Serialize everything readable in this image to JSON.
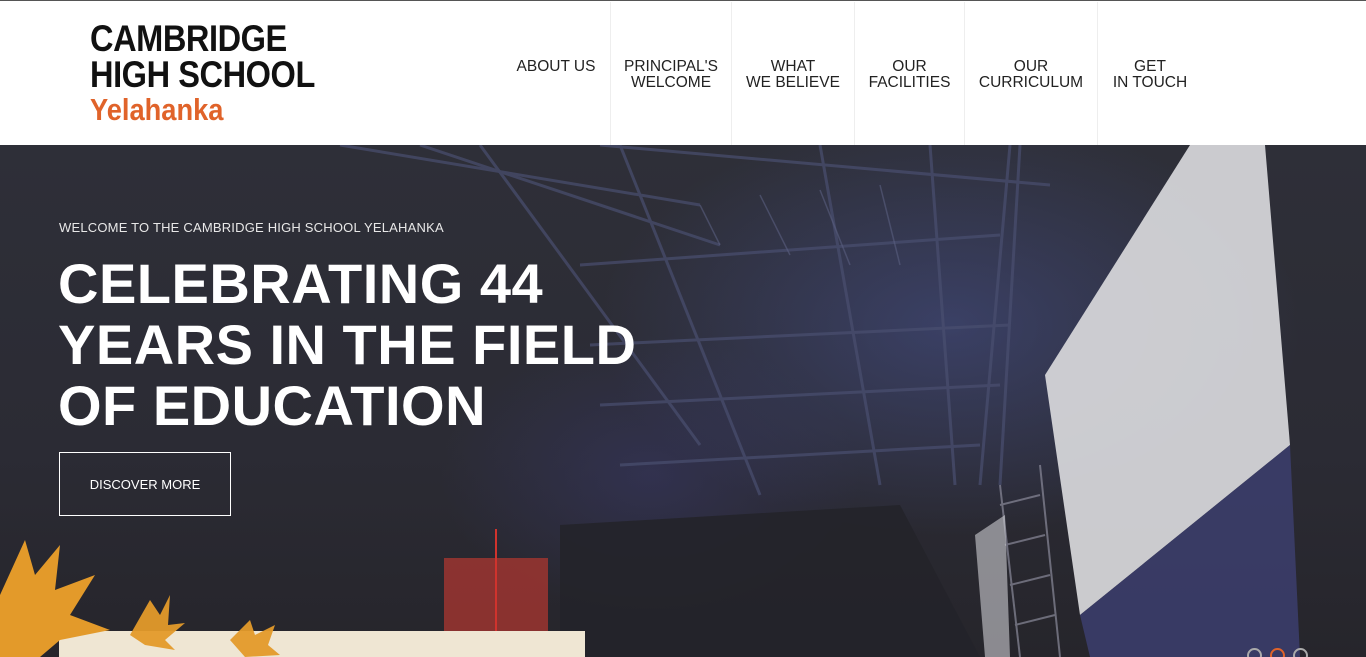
{
  "logo": {
    "line1": "CAMBRIDGE",
    "line2": "HIGH SCHOOL",
    "line3": "Yelahanka"
  },
  "nav": {
    "items": [
      {
        "label": "ABOUT US"
      },
      {
        "label": "PRINCIPAL'S\nWELCOME"
      },
      {
        "label": "WHAT\nWE BELIEVE"
      },
      {
        "label": "OUR\nFACILITIES"
      },
      {
        "label": "OUR\nCURRICULUM"
      },
      {
        "label": "GET\nIN TOUCH"
      }
    ]
  },
  "hero": {
    "welcome": "WELCOME TO THE CAMBRIDGE HIGH SCHOOL YELAHANKA",
    "headline": "CELEBRATING 44 YEARS IN THE FIELD OF EDUCATION",
    "cta_label": "DISCOVER MORE",
    "slides_total": 3,
    "slide_active": 2
  },
  "colors": {
    "accent": "#e0632a",
    "hero_bg": "#2c2c31"
  }
}
